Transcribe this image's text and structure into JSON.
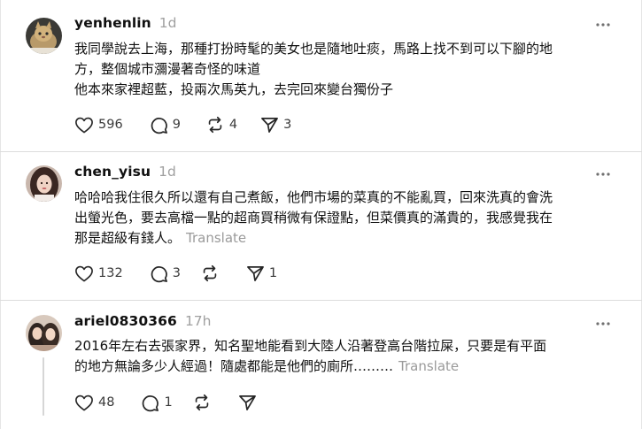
{
  "posts": [
    {
      "username": "yenhenlin",
      "time": "1d",
      "lines": [
        "我同學說去上海，那種打扮時髦的美女也是隨地吐痰，馬路上找不到可以下腳的地",
        "方，整個城市瀰漫著奇怪的味道",
        "他本來家裡超藍，投兩次馬英九，去完回來變台獨份子"
      ],
      "translate": "",
      "likes": "596",
      "replies": "9",
      "reposts": "4",
      "shares": "3",
      "avatar_icon": "cat-photo"
    },
    {
      "username": "chen_yisu",
      "time": "1d",
      "lines": [
        "哈哈哈我住很久所以還有自己煮飯，他們市場的菜真的不能亂買，回來洗真的會洗",
        "出螢光色，要去高檔一點的超商買稍微有保證點，但菜價真的滿貴的，我感覺我在",
        "那是超級有錢人。"
      ],
      "translate": "Translate",
      "likes": "132",
      "replies": "3",
      "reposts": "",
      "shares": "1",
      "avatar_icon": "woman-photo"
    },
    {
      "username": "ariel0830366",
      "time": "17h",
      "lines": [
        "2016年左右去張家界，知名聖地能看到大陸人沿著登高台階拉屎，只要是有平面",
        "的地方無論多少人經過！隨處都能是他們的廁所………"
      ],
      "translate": "Translate",
      "likes": "48",
      "replies": "1",
      "reposts": "",
      "shares": "",
      "avatar_icon": "two-people-photo"
    }
  ]
}
